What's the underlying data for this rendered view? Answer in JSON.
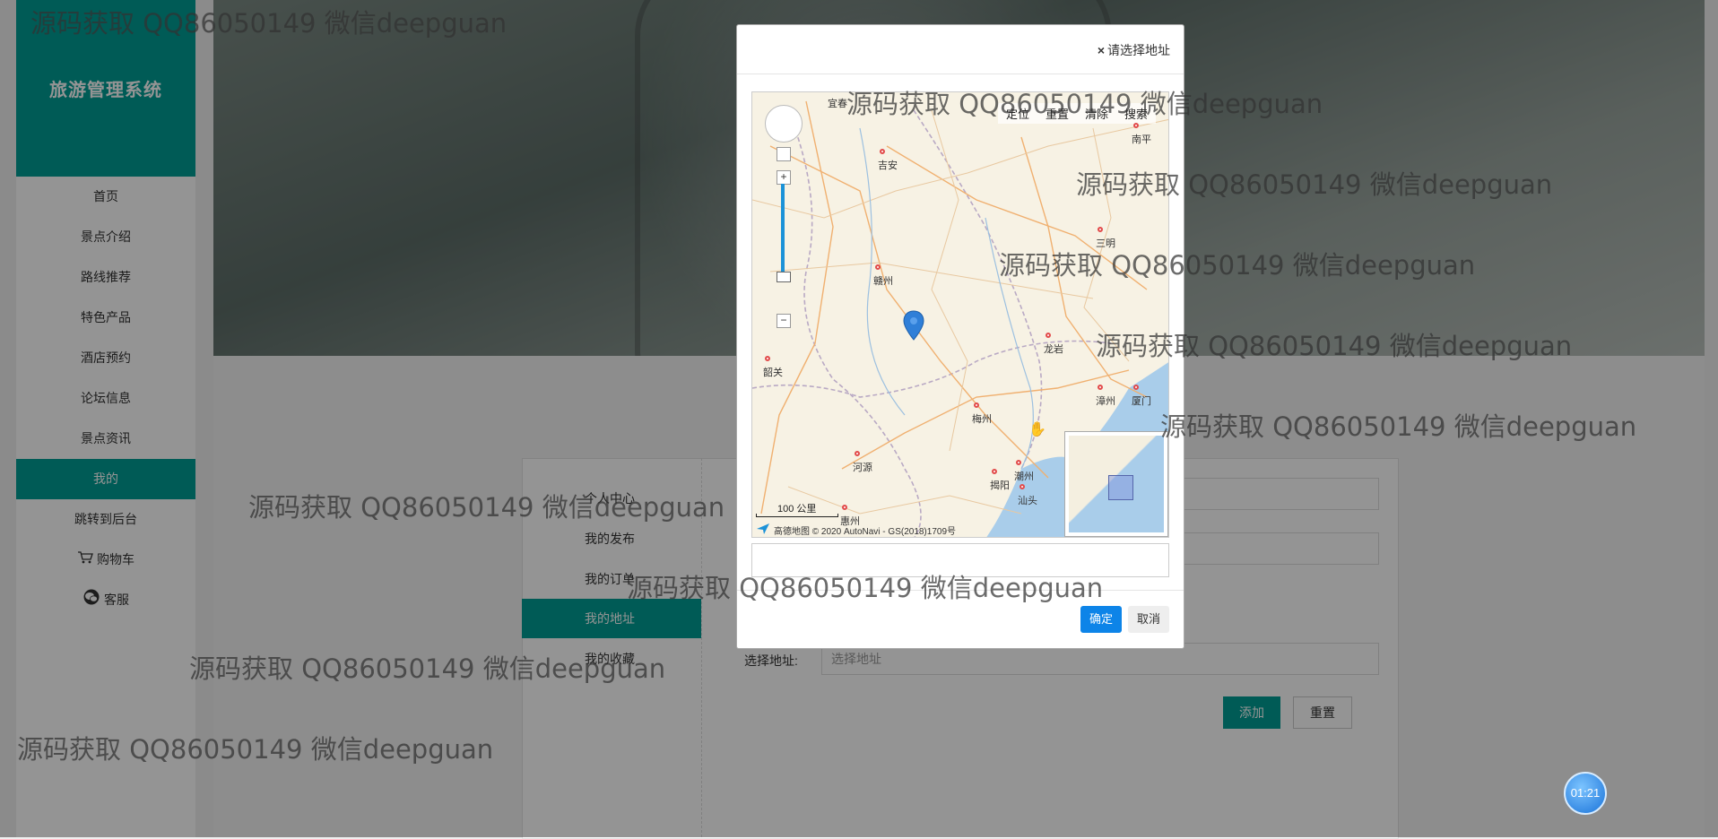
{
  "sidebar": {
    "brand": "旅游管理系统",
    "items": [
      {
        "label": "首页"
      },
      {
        "label": "景点介绍"
      },
      {
        "label": "路线推荐"
      },
      {
        "label": "特色产品"
      },
      {
        "label": "酒店预约"
      },
      {
        "label": "论坛信息"
      },
      {
        "label": "景点资讯"
      },
      {
        "label": "我的",
        "active": true
      },
      {
        "label": "跳转到后台"
      },
      {
        "label": "购物车",
        "icon": "cart-icon"
      },
      {
        "label": "客服",
        "icon": "wechat-icon"
      }
    ]
  },
  "submenu": {
    "items": [
      {
        "label": "个人中心"
      },
      {
        "label": "我的发布"
      },
      {
        "label": "我的订单"
      },
      {
        "label": "我的地址",
        "active": true
      },
      {
        "label": "我的收藏"
      }
    ]
  },
  "form": {
    "address_label": "选择地址:",
    "address_placeholder": "选择地址",
    "add_button": "添加",
    "reset_button": "重置"
  },
  "modal": {
    "title": "请选择地址",
    "close_symbol": "×",
    "toolbar": [
      "定位",
      "重置",
      "清除",
      "搜索"
    ],
    "cities": [
      "宜春",
      "吉安",
      "南平",
      "三明",
      "赣州",
      "龙岩",
      "韶关",
      "漳州",
      "厦门",
      "梅州",
      "河源",
      "潮州",
      "揭阳",
      "汕头",
      "惠州"
    ],
    "scale_label": "100 公里",
    "attribution": "高德地图 © 2020 AutoNavi - GS(2018)1709号",
    "confirm": "确定",
    "cancel": "取消"
  },
  "watermark": "源码获取 QQ86050149 微信deepguan",
  "timer": "01:21",
  "colors": {
    "accent": "#009e94",
    "primary": "#0d84e8"
  }
}
